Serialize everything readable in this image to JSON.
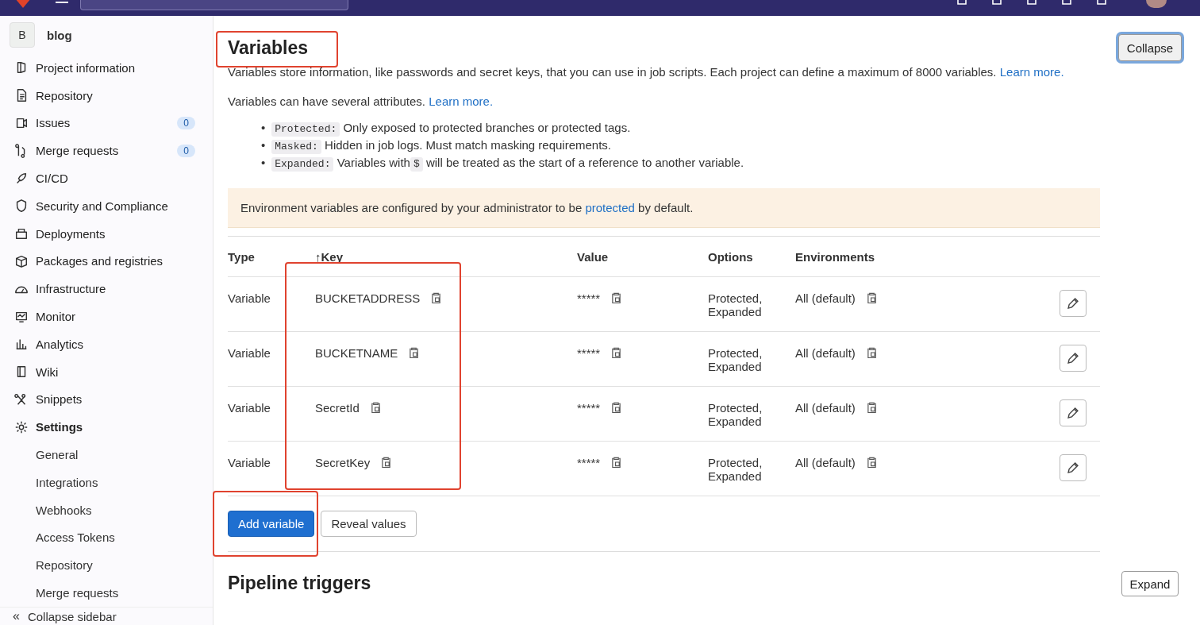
{
  "sidebar": {
    "project": {
      "avatar": "B",
      "name": "blog"
    },
    "items": [
      {
        "label": "Project information",
        "selected": false
      },
      {
        "label": "Repository",
        "selected": false
      },
      {
        "label": "Issues",
        "count": "0",
        "selected": false
      },
      {
        "label": "Merge requests",
        "count": "0",
        "selected": false
      },
      {
        "label": "CI/CD",
        "selected": false
      },
      {
        "label": "Security and Compliance",
        "selected": false
      },
      {
        "label": "Deployments",
        "selected": false
      },
      {
        "label": "Packages and registries",
        "selected": false
      },
      {
        "label": "Infrastructure",
        "selected": false
      },
      {
        "label": "Monitor",
        "selected": false
      },
      {
        "label": "Analytics",
        "selected": false
      },
      {
        "label": "Wiki",
        "selected": false
      },
      {
        "label": "Snippets",
        "selected": false
      },
      {
        "label": "Settings",
        "selected": true,
        "children": [
          {
            "label": "General",
            "selected": false
          },
          {
            "label": "Integrations",
            "selected": false
          },
          {
            "label": "Webhooks",
            "selected": false
          },
          {
            "label": "Access Tokens",
            "selected": false
          },
          {
            "label": "Repository",
            "selected": false
          },
          {
            "label": "Merge requests",
            "selected": false
          }
        ]
      }
    ],
    "collapse_icon": "«",
    "collapse": "Collapse sidebar"
  },
  "section": {
    "title": "Variables",
    "title_highlighted": true,
    "toggle": "Collapse",
    "description": "Variables store information, like passwords and secret keys, that you can use in job scripts. Each project can define a maximum of 8000 variables.",
    "description_link": "Learn more.",
    "attributes_intro": "Variables can have several attributes.",
    "attributes_link": "Learn more.",
    "attributes": [
      {
        "bullet": "•",
        "code": "Protected:",
        "text": "Only exposed to protected branches or protected tags."
      },
      {
        "bullet": "•",
        "code": "Masked:",
        "text": "Hidden in job logs. Must match masking requirements."
      },
      {
        "bullet": "•",
        "code": "Expanded:",
        "text": "Variables with",
        "code_2": "$",
        "text_2": "will be treated as the start of a reference to another variable."
      }
    ],
    "alert": {
      "before": "Environment variables are configured by your administrator to be",
      "link": "protected",
      "after": "by default."
    },
    "table": {
      "columns": [
        {
          "label": "Type"
        },
        {
          "label": "Key",
          "sort": "↑",
          "highlighted": true
        },
        {
          "label": "Value"
        },
        {
          "label": "Options"
        },
        {
          "label": "Environments"
        }
      ],
      "rows": [
        {
          "type": "Variable",
          "key": "BUCKETADDRESS",
          "value": "*****",
          "options": [
            "Protected,",
            "Expanded"
          ],
          "environments": "All (default)"
        },
        {
          "type": "Variable",
          "key": "BUCKETNAME",
          "value": "*****",
          "options": [
            "Protected,",
            "Expanded"
          ],
          "environments": "All (default)"
        },
        {
          "type": "Variable",
          "key": "SecretId",
          "value": "*****",
          "options": [
            "Protected,",
            "Expanded"
          ],
          "environments": "All (default)"
        },
        {
          "type": "Variable",
          "key": "SecretKey",
          "value": "*****",
          "options": [
            "Protected,",
            "Expanded"
          ],
          "environments": "All (default)"
        }
      ]
    },
    "buttons": [
      {
        "label": "Add variable",
        "kind": "primary",
        "highlighted": true
      },
      {
        "label": "Reveal values",
        "kind": "default"
      }
    ]
  },
  "next_section": {
    "title": "Pipeline triggers",
    "toggle": "Expand"
  }
}
